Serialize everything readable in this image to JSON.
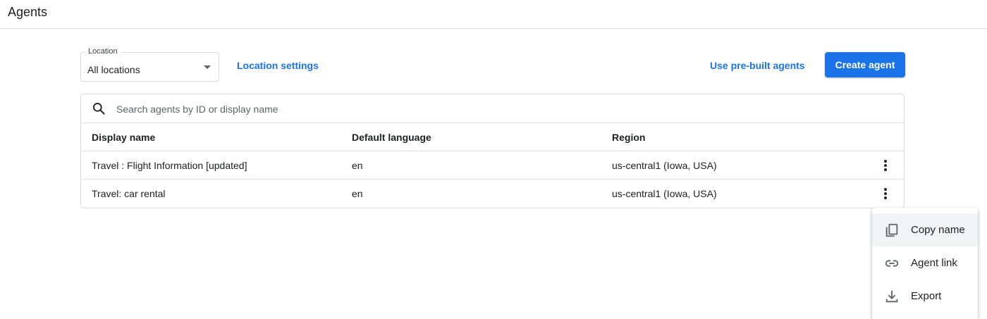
{
  "header": {
    "title": "Agents"
  },
  "toolbar": {
    "location_label": "Location",
    "location_value": "All locations",
    "location_settings": "Location settings",
    "prebuilt": "Use pre-built agents",
    "create": "Create agent"
  },
  "search": {
    "placeholder": "Search agents by ID or display name"
  },
  "table": {
    "columns": [
      "Display name",
      "Default language",
      "Region"
    ],
    "rows": [
      {
        "name": "Travel : Flight Information [updated]",
        "language": "en",
        "region": "us-central1 (Iowa, USA)"
      },
      {
        "name": "Travel: car rental",
        "language": "en",
        "region": "us-central1 (Iowa, USA)"
      }
    ]
  },
  "menu": {
    "items": [
      {
        "label": "Copy name",
        "icon": "copy-icon"
      },
      {
        "label": "Agent link",
        "icon": "link-icon"
      },
      {
        "label": "Export",
        "icon": "download-icon"
      }
    ]
  },
  "colors": {
    "accent": "#1a73e8",
    "border": "#dadce0",
    "text": "#202124"
  }
}
